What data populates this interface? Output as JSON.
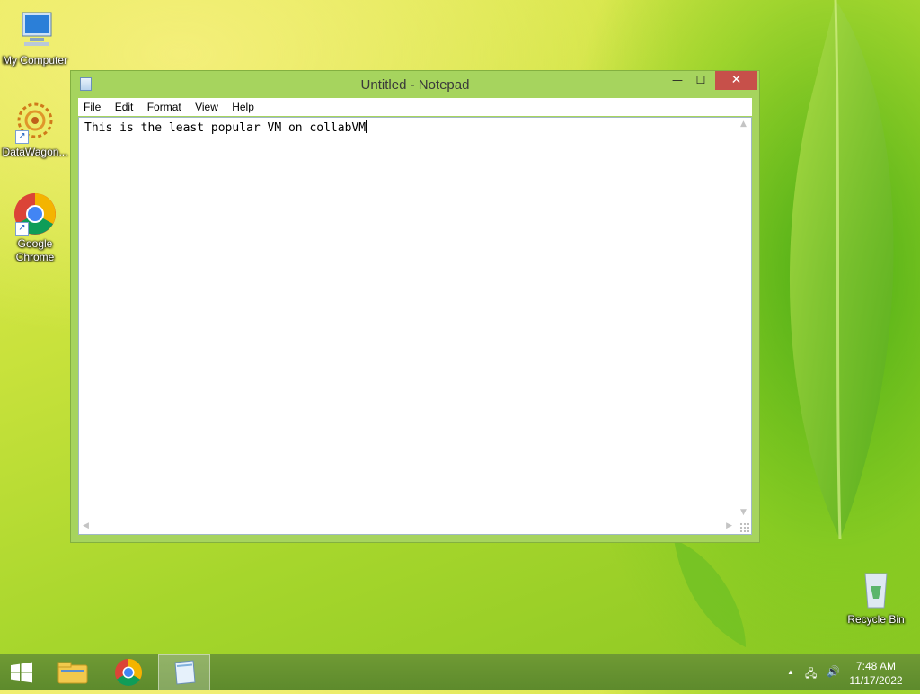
{
  "desktop": {
    "icons": [
      {
        "label": "My Computer"
      },
      {
        "label": "DataWagon..."
      },
      {
        "label": "Google Chrome"
      },
      {
        "label": "Recycle Bin"
      }
    ]
  },
  "window": {
    "title": "Untitled - Notepad",
    "menu": [
      "File",
      "Edit",
      "Format",
      "View",
      "Help"
    ],
    "content": "This is the least popular VM on collabVM"
  },
  "taskbar": {
    "apps": [
      {
        "icon": "windows-logo-icon"
      },
      {
        "icon": "file-explorer-icon"
      },
      {
        "icon": "chrome-icon"
      },
      {
        "icon": "notepad-icon",
        "active": true
      }
    ],
    "clock": {
      "time": "7:48 AM",
      "date": "11/17/2022"
    }
  },
  "colors": {
    "window_frame": "#a6d45e",
    "close_button": "#c7504a",
    "taskbar": "#6f9a34"
  }
}
